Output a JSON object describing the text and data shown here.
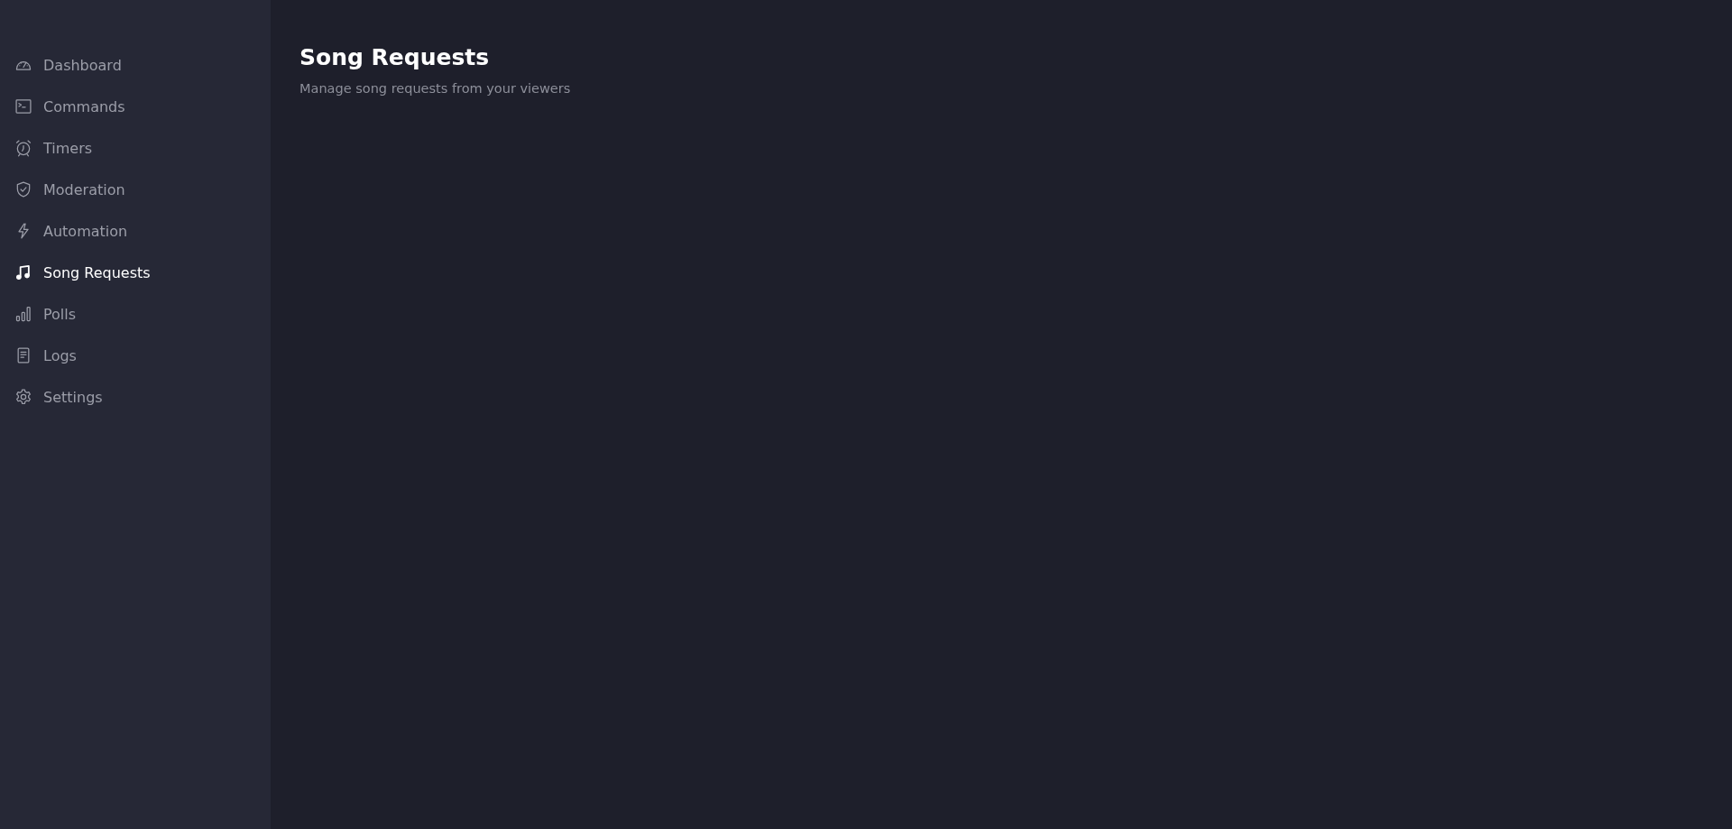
{
  "sidebar": {
    "items": [
      {
        "label": "Dashboard",
        "kind": "gauge",
        "selected": false
      },
      {
        "label": "Commands",
        "kind": "terminal",
        "selected": false
      },
      {
        "label": "Timers",
        "kind": "alarm",
        "selected": false
      },
      {
        "label": "Moderation",
        "kind": "shield",
        "selected": false
      },
      {
        "label": "Automation",
        "kind": "bolt",
        "selected": false
      },
      {
        "label": "Song Requests",
        "kind": "music",
        "selected": true
      },
      {
        "label": "Polls",
        "kind": "chart",
        "selected": false
      },
      {
        "label": "Logs",
        "kind": "document",
        "selected": false
      },
      {
        "label": "Settings",
        "kind": "gear",
        "selected": false
      }
    ]
  },
  "header": {
    "title": "Song Requests",
    "subtitle": "Manage song requests from your viewers"
  }
}
